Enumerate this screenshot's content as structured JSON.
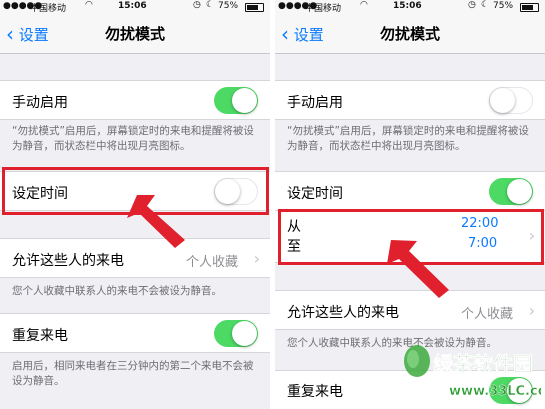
{
  "status": {
    "carrier": "中国移动",
    "time": "15:06",
    "battery": "75%"
  },
  "nav": {
    "back_label": "设置",
    "title": "勿扰模式"
  },
  "left": {
    "manual_label": "手动启用",
    "manual_on": true,
    "manual_footer": "“勿扰模式”启用后，屏幕锁定时的来电和提醒将被设为静音，而状态栏中将出现月亮图标。",
    "scheduled_label": "设定时间",
    "scheduled_on": false,
    "allow_label": "允许这些人的来电",
    "allow_value": "个人收藏",
    "allow_footer": "您个人收藏中联系人的来电不会被设为静音。",
    "repeat_label": "重复来电",
    "repeat_on": true,
    "repeat_footer": "启用后，相同来电者在三分钟内的第二个来电不会被设为静音。"
  },
  "right": {
    "manual_label": "手动启用",
    "manual_on": false,
    "manual_footer": "“勿扰模式”启用后，屏幕锁定时的来电和提醒将被设为静音，而状态栏中将出现月亮图标。",
    "scheduled_label": "设定时间",
    "scheduled_on": true,
    "from_label": "从",
    "from_time": "22:00",
    "to_label": "至",
    "to_time": "7:00",
    "allow_label": "允许这些人的来电",
    "allow_value": "个人收藏",
    "allow_footer": "您个人收藏中联系人的来电不会被设为静音。",
    "repeat_label": "重复来电",
    "repeat_on": true
  },
  "watermark": {
    "name": "绿茶软件园",
    "url": "www.33LC.com"
  },
  "colors": {
    "accent_blue": "#0a7aff",
    "toggle_green": "#4cd964",
    "highlight_red": "#e0202c"
  }
}
